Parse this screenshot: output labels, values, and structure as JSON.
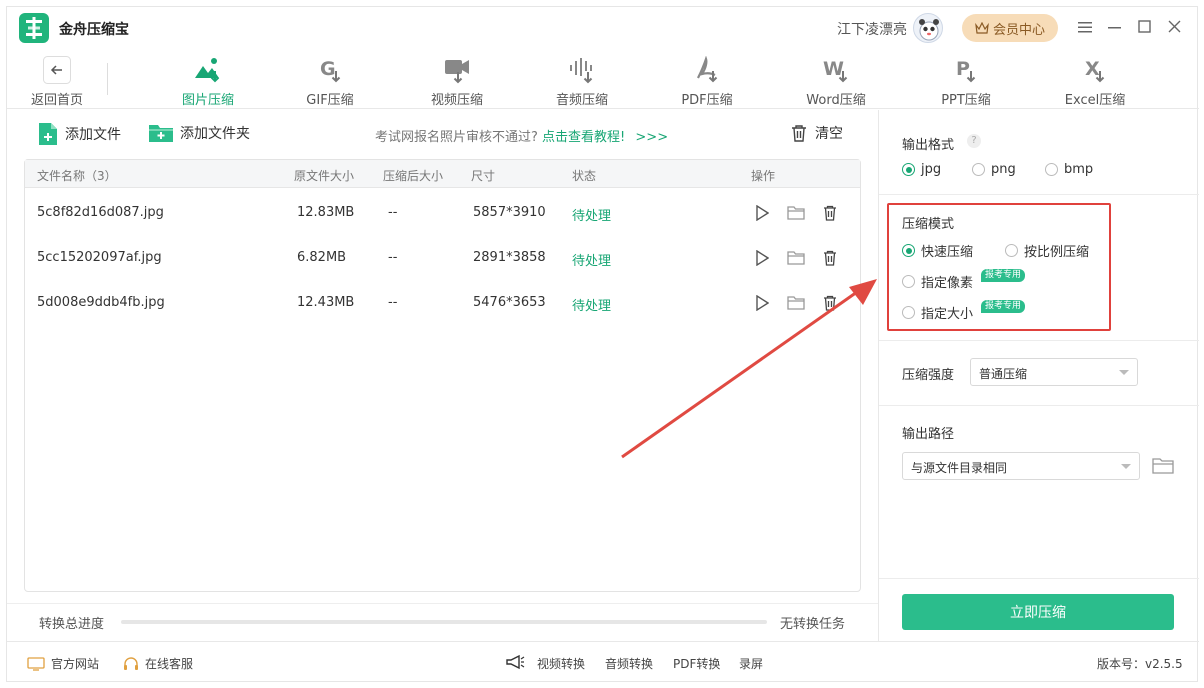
{
  "app": {
    "title": "金舟压缩宝",
    "user_name": "江下凌漂亮",
    "vip_label": "会员中心"
  },
  "colors": {
    "accent": "#18a674",
    "button": "#2bbd8c",
    "highlight": "#e0413c",
    "vip": "#f7dcb8"
  },
  "toolbar": {
    "back_label": "返回首页",
    "tools": [
      {
        "label": "图片压缩",
        "icon": "image-icon",
        "active": true
      },
      {
        "label": "GIF压缩",
        "icon": "gif-icon",
        "active": false
      },
      {
        "label": "视频压缩",
        "icon": "video-icon",
        "active": false
      },
      {
        "label": "音频压缩",
        "icon": "audio-icon",
        "active": false
      },
      {
        "label": "PDF压缩",
        "icon": "pdf-icon",
        "active": false
      },
      {
        "label": "Word压缩",
        "icon": "word-icon",
        "active": false
      },
      {
        "label": "PPT压缩",
        "icon": "ppt-icon",
        "active": false
      },
      {
        "label": "Excel压缩",
        "icon": "excel-icon",
        "active": false
      }
    ]
  },
  "file_actions": {
    "add_file": "添加文件",
    "add_folder": "添加文件夹",
    "hint": "考试网报名照片审核不通过?",
    "hint_link": "点击查看教程!",
    "hint_arrows": ">>>",
    "clear": "清空"
  },
  "table": {
    "headers": [
      "文件名称（3）",
      "原文件大小",
      "压缩后大小",
      "尺寸",
      "状态",
      "操作"
    ],
    "rows": [
      {
        "name": "5c8f82d16d087.jpg",
        "size": "12.83MB",
        "compressed": "--",
        "dims": "5857*3910",
        "status": "待处理"
      },
      {
        "name": "5cc15202097af.jpg",
        "size": "6.82MB",
        "compressed": "--",
        "dims": "2891*3858",
        "status": "待处理"
      },
      {
        "name": "5d008e9ddb4fb.jpg",
        "size": "12.43MB",
        "compressed": "--",
        "dims": "5476*3653",
        "status": "待处理"
      }
    ]
  },
  "progress": {
    "label": "转换总进度",
    "status": "无转换任务",
    "fraction": 0
  },
  "settings": {
    "format_title": "输出格式",
    "formats": [
      {
        "label": "jpg",
        "selected": true
      },
      {
        "label": "png",
        "selected": false
      },
      {
        "label": "bmp",
        "selected": false
      }
    ],
    "mode_title": "压缩模式",
    "modes": [
      {
        "label": "快速压缩",
        "selected": true,
        "tag": ""
      },
      {
        "label": "按比例压缩",
        "selected": false,
        "tag": ""
      },
      {
        "label": "指定像素",
        "selected": false,
        "tag": "报考专用"
      },
      {
        "label": "指定大小",
        "selected": false,
        "tag": "报考专用"
      }
    ],
    "strength_title": "压缩强度",
    "strength_value": "普通压缩",
    "output_title": "输出路径",
    "output_value": "与源文件目录相同",
    "start_button": "立即压缩"
  },
  "footer": {
    "website": "官方网站",
    "support": "在线客服",
    "links": [
      "视频转换",
      "音频转换",
      "PDF转换",
      "录屏"
    ],
    "version": "版本号：v2.5.5"
  }
}
